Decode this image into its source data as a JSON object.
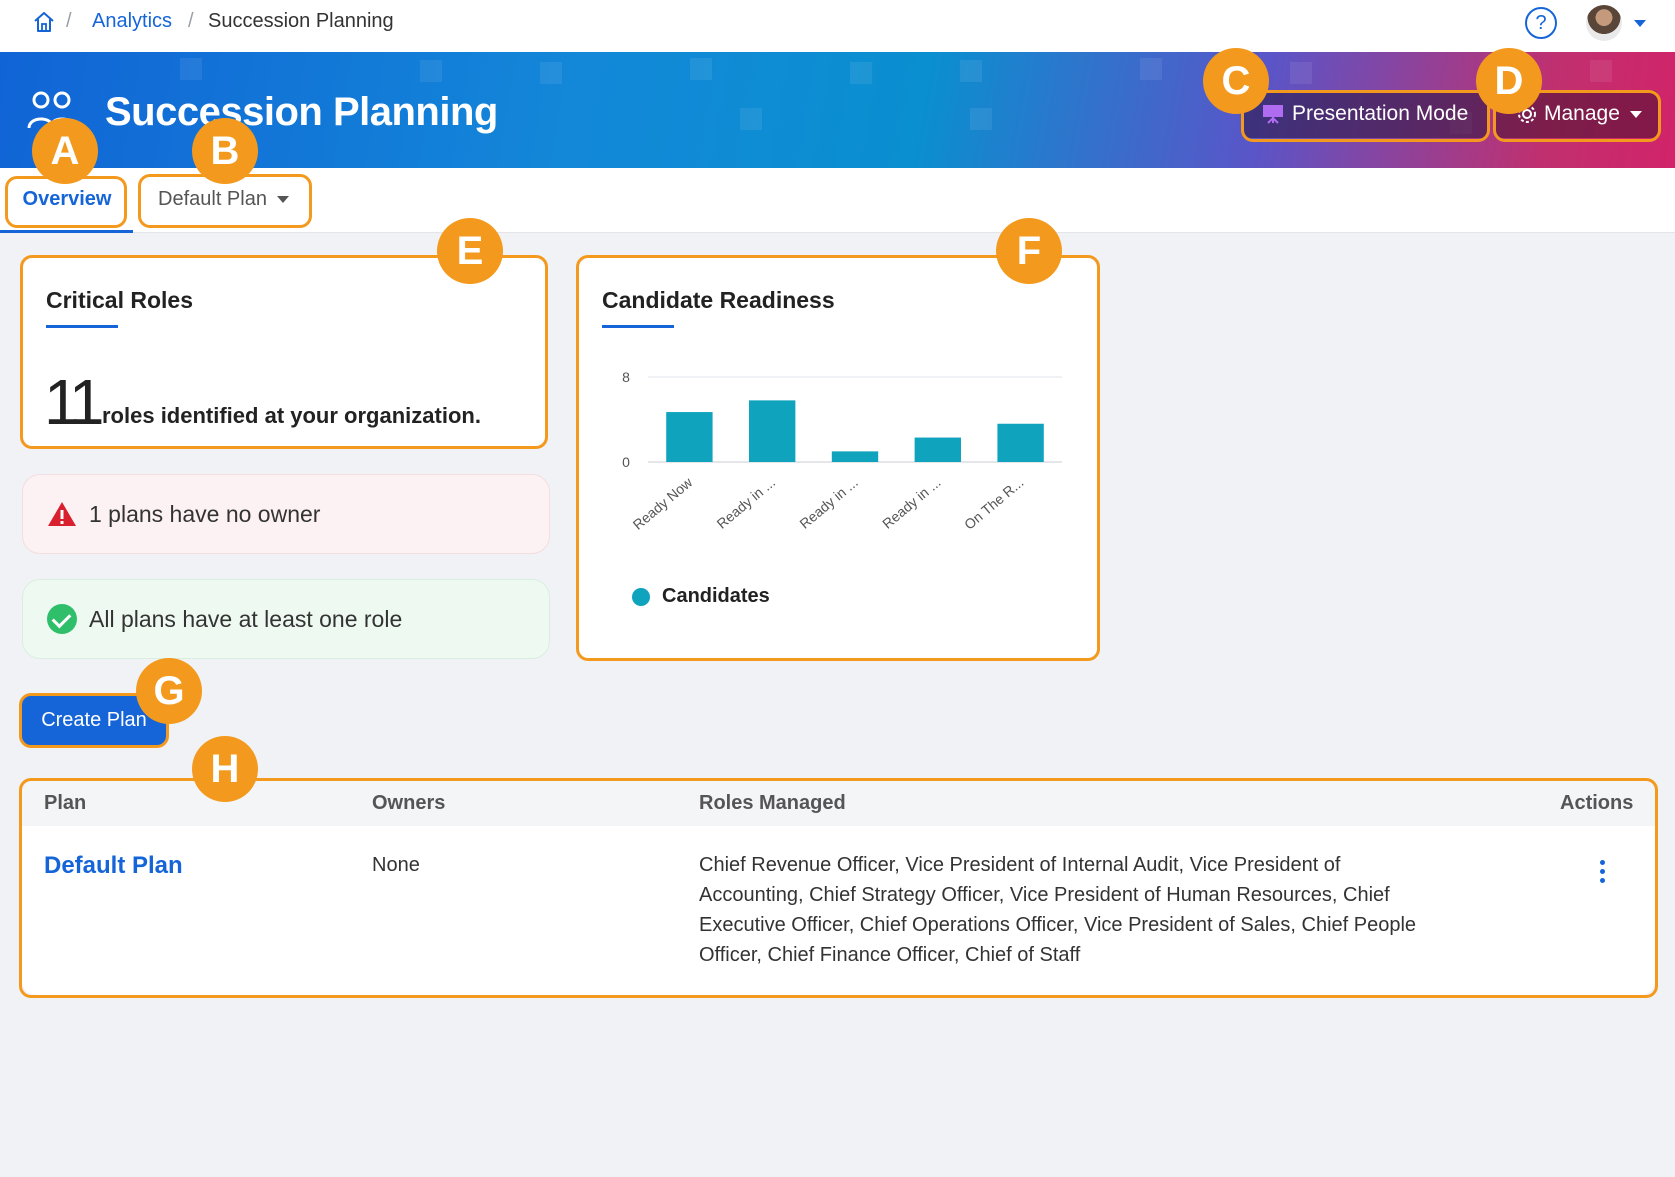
{
  "breadcrumb": {
    "separator": "/",
    "parent": "Analytics",
    "current": "Succession Planning"
  },
  "header": {
    "help_icon": "?",
    "title": "Succession Planning",
    "presentation_label": "Presentation Mode",
    "manage_label": "Manage"
  },
  "tabs": {
    "overview": "Overview",
    "plan_select": "Default Plan"
  },
  "critical_roles": {
    "title": "Critical Roles",
    "count": "11",
    "text": "roles identified at your organization."
  },
  "alerts": {
    "warning": "1 plans have no owner",
    "success": "All plans have at least one role"
  },
  "chart_data": {
    "type": "bar",
    "title": "Candidate Readiness",
    "categories": [
      "Ready Now",
      "Ready in ...",
      "Ready in ...",
      "Ready in ...",
      "On The R..."
    ],
    "series": [
      {
        "name": "Candidates",
        "values": [
          4.7,
          5.8,
          1.0,
          2.3,
          3.6
        ]
      }
    ],
    "ylim": [
      0,
      8
    ],
    "yticks": [
      "0",
      "8"
    ],
    "color": "#0fa3bd",
    "legend_position": "bottom-left"
  },
  "actions": {
    "create_plan": "Create Plan"
  },
  "table": {
    "headers": {
      "plan": "Plan",
      "owners": "Owners",
      "roles": "Roles Managed",
      "actions": "Actions"
    },
    "rows": [
      {
        "plan": "Default Plan",
        "owners": "None",
        "roles": "Chief Revenue Officer, Vice President of Internal Audit, Vice President of Accounting, Chief Strategy Officer, Vice President of Human Resources, Chief Executive Officer, Chief Operations Officer, Vice President of Sales, Chief People Officer, Chief Finance Officer, Chief of Staff"
      }
    ]
  },
  "annotations": {
    "a": "A",
    "b": "B",
    "c": "C",
    "d": "D",
    "e": "E",
    "f": "F",
    "g": "G",
    "h": "H"
  },
  "colors": {
    "accent": "#1565d8",
    "annotation": "#f39a1e",
    "bar": "#0fa3bd",
    "warning": "#d8202f",
    "success": "#2fbf6b"
  }
}
